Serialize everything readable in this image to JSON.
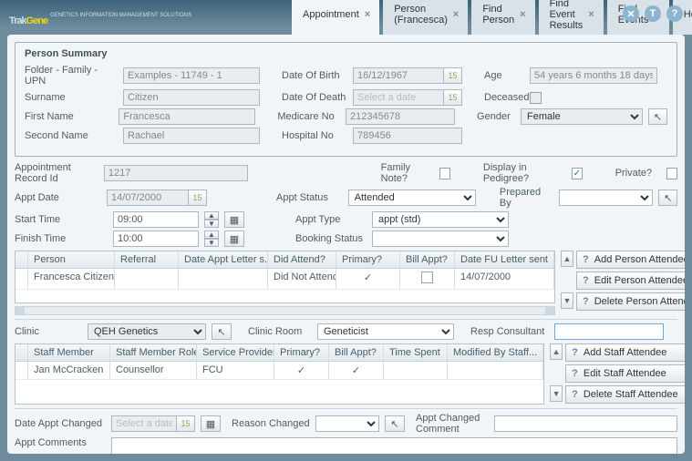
{
  "app": {
    "logo1": "Trak",
    "logo2": "Gene",
    "sub": "GENETICS INFORMATION MANAGEMENT SOLUTIONS"
  },
  "topicons": {
    "close": "✕",
    "info": "T",
    "help": "?"
  },
  "tabs": [
    {
      "label": "Appointment",
      "closable": true,
      "active": true
    },
    {
      "label": "Person (Francesca)",
      "closable": true
    },
    {
      "label": "Find Person",
      "closable": true
    },
    {
      "label": "Find Event Results",
      "closable": true
    },
    {
      "label": "Find Events",
      "closable": true
    },
    {
      "label": "Home",
      "closable": false
    }
  ],
  "summary": {
    "title": "Person Summary",
    "folder_lbl": "Folder - Family - UPN",
    "folder_val": "Examples - 11749 - 1",
    "surname_lbl": "Surname",
    "surname_val": "Citizen",
    "first_lbl": "First Name",
    "first_val": "Francesca",
    "second_lbl": "Second Name",
    "second_val": "Rachael",
    "dob_lbl": "Date Of Birth",
    "dob_val": "16/12/1967",
    "dod_lbl": "Date Of Death",
    "dod_val": "Select a date",
    "medicare_lbl": "Medicare No",
    "medicare_val": "212345678",
    "hospital_lbl": "Hospital No",
    "hospital_val": "789456",
    "age_lbl": "Age",
    "age_val": "54 years 6 months 18 days",
    "deceased_lbl": "Deceased",
    "gender_lbl": "Gender",
    "gender_val": "Female"
  },
  "appt": {
    "recid_lbl": "Appointment Record Id",
    "recid_val": "1217",
    "famnote_lbl": "Family Note?",
    "pedigree_lbl": "Display in Pedigree?",
    "pedigree_chk": "✓",
    "private_lbl": "Private?",
    "date_lbl": "Appt Date",
    "date_val": "14/07/2000",
    "status_lbl": "Appt Status",
    "status_val": "Attended",
    "prep_lbl": "Prepared By",
    "prep_val": "",
    "start_lbl": "Start Time",
    "start_val": "09:00",
    "type_lbl": "Appt Type",
    "type_val": "appt (std)",
    "finish_lbl": "Finish Time",
    "finish_val": "10:00",
    "booking_lbl": "Booking Status",
    "booking_val": ""
  },
  "attendees": {
    "cols": [
      "Person",
      "Referral",
      "Date Appt Letter s...",
      "Did Attend?",
      "Primary?",
      "Bill Appt?",
      "Date FU Letter sent"
    ],
    "row": {
      "person": "Francesca Citizen",
      "referral": "",
      "date_letter": "",
      "did": "Did Not Attend",
      "primary": "✓",
      "bill": "",
      "fu": "14/07/2000"
    },
    "b_add": "Add Person Attendee",
    "b_edit": "Edit Person Attendee",
    "b_del": "Delete Person Attendee"
  },
  "clinic": {
    "clinic_lbl": "Clinic",
    "clinic_val": "QEH Genetics",
    "room_lbl": "Clinic Room",
    "room_val": "Geneticist",
    "resp_lbl": "Resp Consultant",
    "resp_val": ""
  },
  "staff": {
    "cols": [
      "Staff Member",
      "Staff Member Role",
      "Service Provider",
      "Primary?",
      "Bill Appt?",
      "Time Spent",
      "Modified By Staff..."
    ],
    "row": {
      "name": "Jan McCracken",
      "role": "Counsellor",
      "prov": "FCU",
      "primary": "✓",
      "bill": "✓",
      "time": "",
      "mod": ""
    },
    "b_add": "Add Staff Attendee",
    "b_edit": "Edit Staff Attendee",
    "b_del": "Delete Staff Attendee"
  },
  "footer": {
    "changed_lbl": "Date Appt Changed",
    "changed_val": "Select a date",
    "reason_lbl": "Reason Changed",
    "reason_val": "",
    "chgcomment_lbl": "Appt Changed Comment",
    "comments_lbl": "Appt Comments"
  }
}
